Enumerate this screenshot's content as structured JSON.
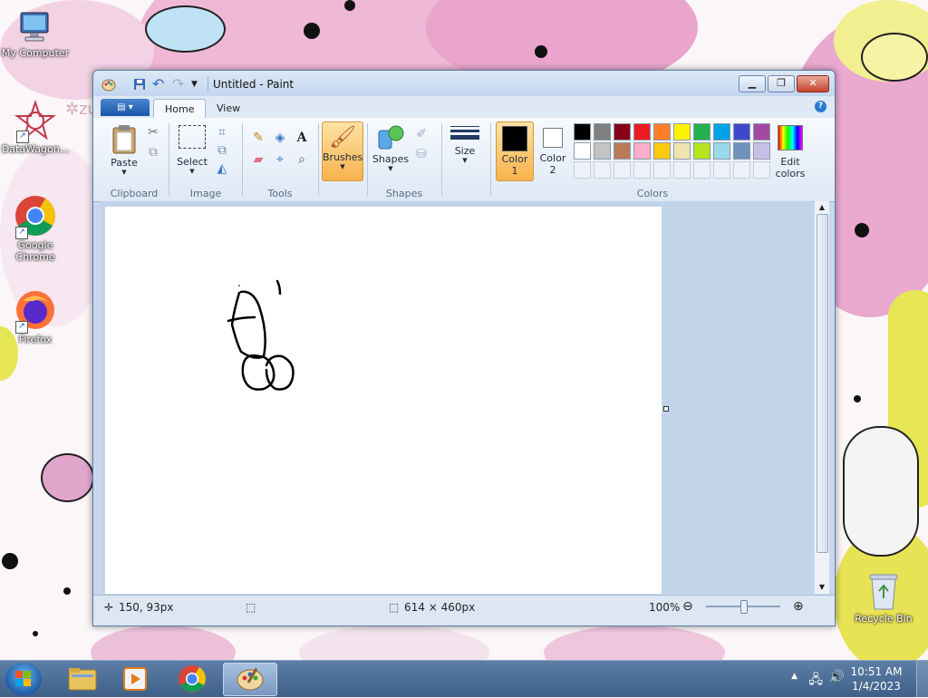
{
  "desktop": {
    "icons": [
      {
        "label": "My Computer"
      },
      {
        "label": "DataWagon..."
      },
      {
        "label": "Google Chrome"
      },
      {
        "label": "Firefox"
      },
      {
        "label": "Recycle Bin"
      }
    ],
    "partial_logo_text": "zu"
  },
  "window": {
    "title": "Untitled - Paint",
    "tabs": {
      "home": "Home",
      "view": "View"
    },
    "help": "?"
  },
  "ribbon": {
    "clipboard": {
      "paste": "Paste",
      "group": "Clipboard"
    },
    "image": {
      "select": "Select",
      "group": "Image"
    },
    "tools": {
      "group": "Tools"
    },
    "brushes": {
      "label": "Brushes"
    },
    "shapes": {
      "label": "Shapes",
      "group": "Shapes"
    },
    "size": {
      "label": "Size"
    },
    "color1": {
      "line1": "Color",
      "line2": "1",
      "value": "#000000"
    },
    "color2": {
      "line1": "Color",
      "line2": "2",
      "value": "#ffffff"
    },
    "edit_colors": {
      "line1": "Edit",
      "line2": "colors"
    },
    "colors_group": "Colors",
    "palette_row1": [
      "#000000",
      "#7f7f7f",
      "#880015",
      "#ed1c24",
      "#ff7f27",
      "#fff200",
      "#22b14c",
      "#00a2e8",
      "#3f48cc",
      "#a349a4"
    ],
    "palette_row2": [
      "#ffffff",
      "#c3c3c3",
      "#b97a57",
      "#ffaec9",
      "#ffc90e",
      "#efe4b0",
      "#b5e61d",
      "#99d9ea",
      "#7092be",
      "#c8bfe7"
    ]
  },
  "status": {
    "cursor_pos": "150, 93px",
    "canvas_size": "614 × 460px",
    "zoom": "100%"
  },
  "taskbar": {
    "time": "10:51 AM",
    "date": "1/4/2023"
  }
}
